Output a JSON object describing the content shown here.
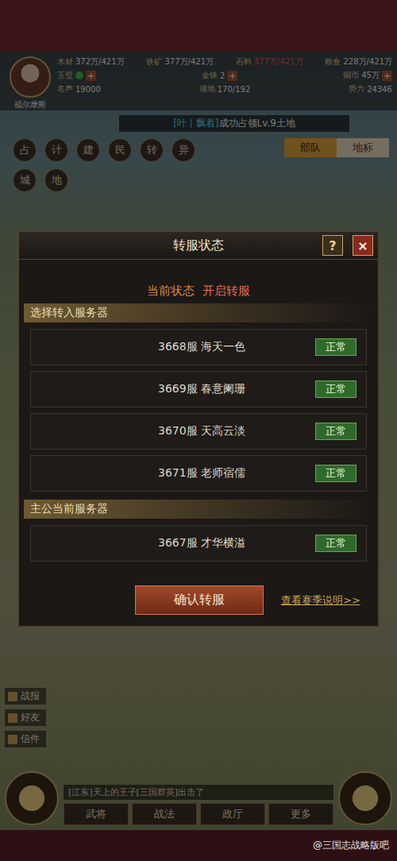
{
  "player": {
    "name": "福尔摩斯"
  },
  "resources": [
    {
      "name": "木材",
      "value": "372万/421万",
      "warning": false
    },
    {
      "name": "铁矿",
      "value": "377万/421万",
      "warning": false
    },
    {
      "name": "石料",
      "value": "377万/421万",
      "warning": true
    },
    {
      "name": "粮食",
      "value": "228万/421万",
      "warning": false
    }
  ],
  "currencies": [
    {
      "name": "玉璧",
      "kind": "icon",
      "value": "",
      "plus": "+"
    },
    {
      "name": "金铢",
      "kind": "number",
      "value": "2",
      "plus": "+"
    },
    {
      "name": "铜币",
      "kind": "number",
      "value": "45万",
      "plus": "+"
    }
  ],
  "stats": [
    {
      "name": "名声",
      "value": "19000"
    },
    {
      "name": "领地",
      "value": "170/192"
    },
    {
      "name": "势力",
      "value": "24346"
    }
  ],
  "banner": {
    "tag": "[叶丨飘着]",
    "message": "成功占领Lv.9土地"
  },
  "quick_icons": [
    "占",
    "计",
    "建",
    "民",
    "转",
    "异",
    "城",
    "地"
  ],
  "map_tabs": [
    {
      "label": "部队",
      "selected": true
    },
    {
      "label": "地标",
      "selected": false
    }
  ],
  "dialog": {
    "title": "转服状态",
    "help": "?",
    "close": "×",
    "status_label": "当前状态",
    "status_value": "开启转服",
    "target_header": "选择转入服务器",
    "targets": [
      {
        "server": "3668服 海天一色",
        "state": "正常"
      },
      {
        "server": "3669服 春意阑珊",
        "state": "正常"
      },
      {
        "server": "3670服 天高云淡",
        "state": "正常"
      },
      {
        "server": "3671服 老师宿儒",
        "state": "正常"
      }
    ],
    "current_header": "主公当前服务器",
    "current": {
      "server": "3667服 才华横溢",
      "state": "正常"
    },
    "confirm": "确认转服",
    "link": "查看赛季说明>>"
  },
  "side_menu": [
    "战报",
    "好友",
    "信件"
  ],
  "chat": "[江东]天上的王子[三国群英]出击了",
  "bottom_nav": [
    "武将",
    "战法",
    "政厅",
    "更多"
  ],
  "watermark": "@三国志战略版吧"
}
